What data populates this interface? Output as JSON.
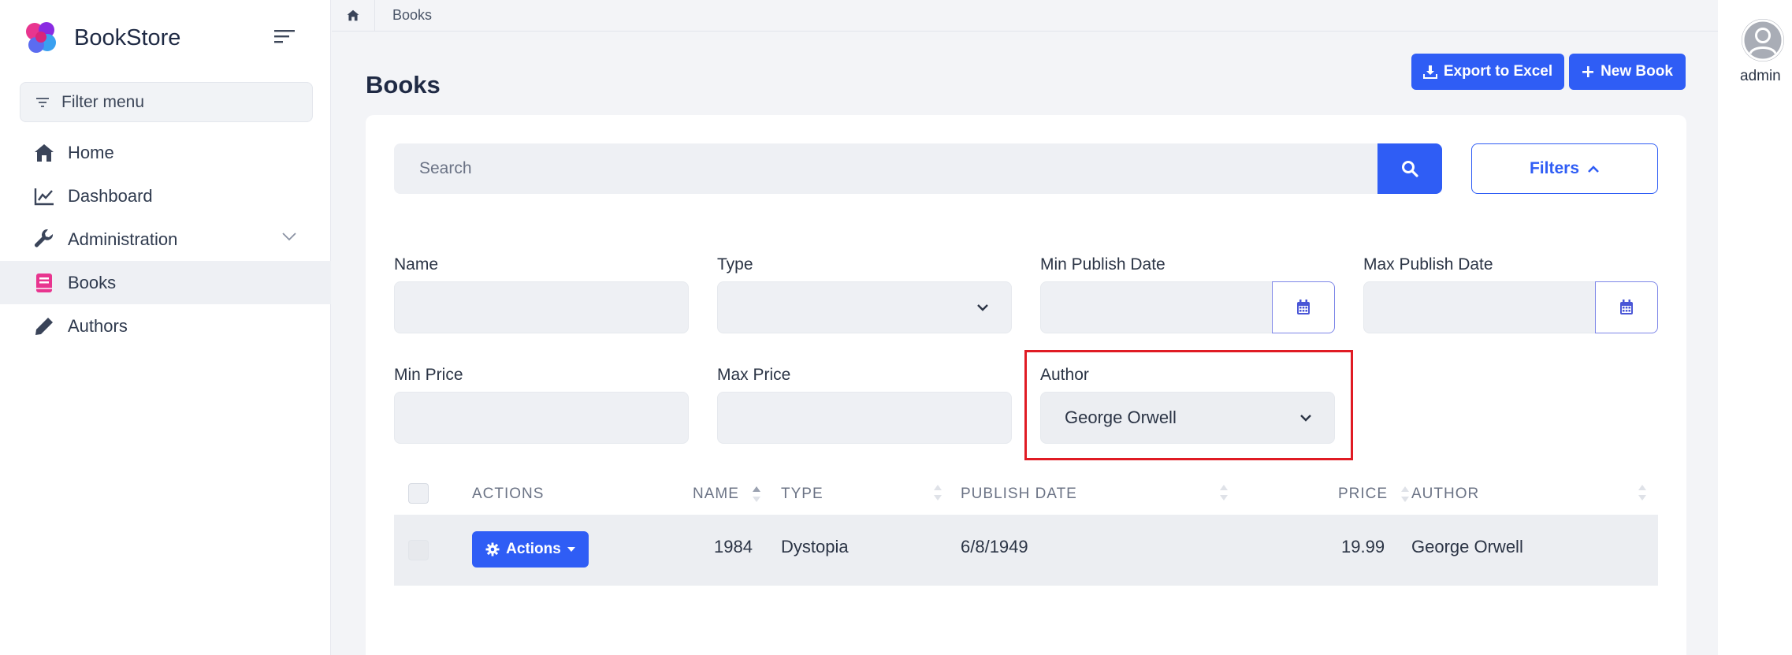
{
  "brand": {
    "name": "BookStore"
  },
  "sidebar": {
    "filter_placeholder": "Filter menu",
    "items": [
      {
        "label": "Home",
        "icon": "home-icon"
      },
      {
        "label": "Dashboard",
        "icon": "chart-line-icon"
      },
      {
        "label": "Administration",
        "icon": "wrench-icon"
      },
      {
        "label": "Books",
        "icon": "book-icon",
        "active": true
      },
      {
        "label": "Authors",
        "icon": "pencil-icon"
      }
    ]
  },
  "breadcrumb": {
    "current": "Books"
  },
  "page": {
    "title": "Books",
    "export_label": "Export to Excel",
    "new_label": "New Book"
  },
  "search": {
    "placeholder": "Search",
    "filters_label": "Filters"
  },
  "filters": {
    "name_label": "Name",
    "type_label": "Type",
    "min_date_label": "Min Publish Date",
    "max_date_label": "Max Publish Date",
    "min_price_label": "Min Price",
    "max_price_label": "Max Price",
    "author_label": "Author",
    "author_value": "George Orwell"
  },
  "table": {
    "headers": {
      "actions": "ACTIONS",
      "name": "NAME",
      "type": "TYPE",
      "publish_date": "PUBLISH DATE",
      "price": "PRICE",
      "author": "AUTHOR"
    },
    "rows": [
      {
        "actions_label": "Actions",
        "name": "1984",
        "type": "Dystopia",
        "publish_date": "6/8/1949",
        "price": "19.99",
        "author": "George Orwell"
      }
    ]
  },
  "user": {
    "name": "admin"
  },
  "colors": {
    "primary": "#2f5df5",
    "highlight": "#e01b24",
    "brand_pink": "#e8358f"
  }
}
